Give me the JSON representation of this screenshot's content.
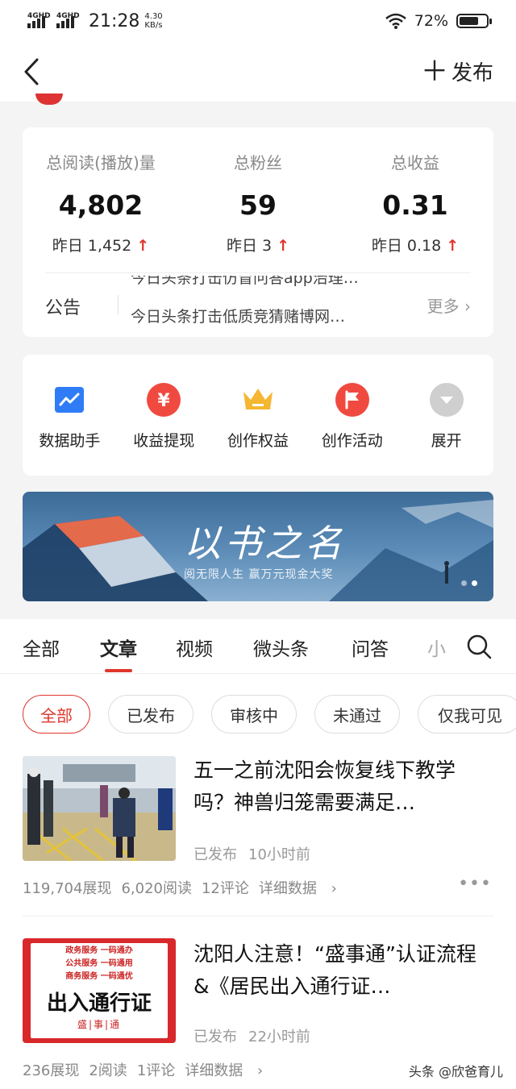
{
  "status_bar": {
    "network_1": "4GHD",
    "network_2": "4GHD",
    "time": "21:28",
    "speed_value": "4.30",
    "speed_unit": "KB/s",
    "battery": "72%",
    "battery_level": 0.72
  },
  "header": {
    "publish_label": "发布"
  },
  "stats": {
    "items": [
      {
        "title": "总阅读(播放)量",
        "value": "4,802",
        "yesterday": "昨日 1,452"
      },
      {
        "title": "总粉丝",
        "value": "59",
        "yesterday": "昨日 3"
      },
      {
        "title": "总收益",
        "value": "0.31",
        "yesterday": "昨日 0.18"
      }
    ],
    "notice_label": "公告",
    "notice_line_1": "今日头条打击仿冒问答app治理…",
    "notice_line_2": "今日头条打击低质竞猜赌博网…",
    "more_label": "更多"
  },
  "tools": [
    {
      "label": "数据助手",
      "icon": "chart-icon"
    },
    {
      "label": "收益提现",
      "icon": "yuan-icon"
    },
    {
      "label": "创作权益",
      "icon": "crown-icon"
    },
    {
      "label": "创作活动",
      "icon": "flag-icon"
    },
    {
      "label": "展开",
      "icon": "chevron-down-icon"
    }
  ],
  "banner": {
    "title": "以书之名",
    "subtitle": "阅无限人生  赢万元现金大奖"
  },
  "tabs": [
    "全部",
    "文章",
    "视频",
    "微头条",
    "问答",
    "小"
  ],
  "active_tab": "文章",
  "filters": [
    "全部",
    "已发布",
    "审核中",
    "未通过",
    "仅我可见"
  ],
  "articles": [
    {
      "title": "五一之前沈阳会恢复线下教学吗？神兽归笼需要满足…",
      "status": "已发布",
      "time": "10小时前",
      "impressions": "119,704展现",
      "reads": "6,020阅读",
      "comments": "12评论",
      "detail_label": "详细数据"
    },
    {
      "title": "沈阳人注意！“盛事通”认证流程&《居民出入通行证…",
      "status": "已发布",
      "time": "22小时前",
      "impressions": "236展现",
      "reads": "2阅读",
      "comments": "1评论",
      "detail_label": "详细数据",
      "thumb_lines": [
        "政务服务 一码通办",
        "公共服务 一码通用",
        "商务服务 一码通优"
      ],
      "thumb_title": "出入通行证",
      "thumb_brand": "盛|事|通"
    }
  ],
  "watermark": "头条 @欣爸育儿",
  "colors": {
    "accent": "#e0352b",
    "chart_icon_bg": "#2f7cf6",
    "yuan_icon_bg": "#f04a40",
    "crown_icon": "#f5b731",
    "flag_icon_bg": "#f04a40",
    "expand_icon_bg": "#cfcfcf"
  }
}
